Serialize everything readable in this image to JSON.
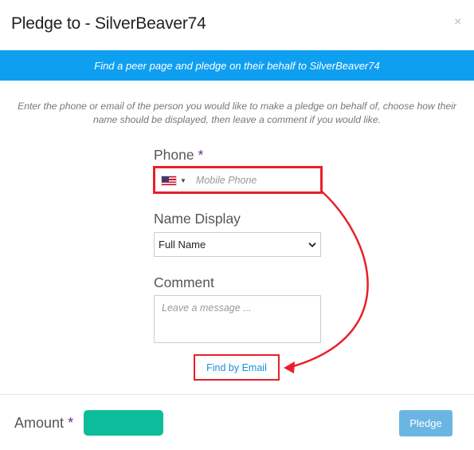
{
  "dialog": {
    "title": "Pledge to - SilverBeaver74",
    "close_glyph": "×",
    "banner_text": "Find a peer page and pledge on their behalf to SilverBeaver74",
    "instructions": "Enter the phone or email of the person you would like to make a pledge on behalf of, choose how their name should be displayed, then leave a comment if you would like."
  },
  "form": {
    "phone": {
      "label": "Phone",
      "required_mark": "*",
      "country_flag": "us-flag-icon",
      "placeholder": "Mobile Phone",
      "value": ""
    },
    "name_display": {
      "label": "Name Display",
      "selected": "Full Name"
    },
    "comment": {
      "label": "Comment",
      "placeholder": "Leave a message ...",
      "value": ""
    },
    "find_by_email_label": "Find by Email"
  },
  "footer": {
    "amount_label": "Amount",
    "required_mark": "*",
    "amount_value": "",
    "pledge_label": "Pledge"
  },
  "colors": {
    "banner": "#0f9ff0",
    "required": "#6a2c91",
    "annotation_red": "#e8202a",
    "amount_fill": "#0bbd9b",
    "pledge_button": "#6bb5e3",
    "link": "#1a8fd8"
  }
}
